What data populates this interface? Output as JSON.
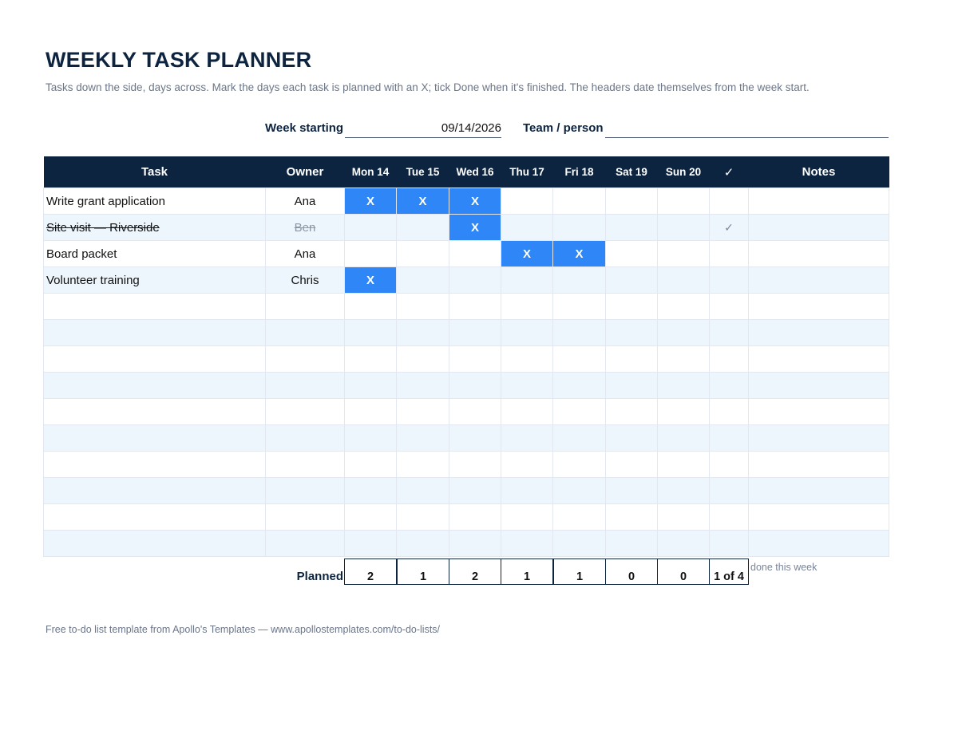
{
  "title": "WEEKLY TASK PLANNER",
  "subtitle": "Tasks down the side, days across. Mark the days each task is planned with an X; tick Done when it's finished. The headers date themselves from the week start.",
  "fields": {
    "week_label": "Week starting",
    "week_value": "09/14/2026",
    "team_label": "Team / person",
    "team_value": ""
  },
  "headers": {
    "task": "Task",
    "owner": "Owner",
    "days": [
      "Mon 14",
      "Tue 15",
      "Wed 16",
      "Thu 17",
      "Fri 18",
      "Sat 19",
      "Sun 20"
    ],
    "done": "✓",
    "notes": "Notes"
  },
  "rows": [
    {
      "task": "Write grant application",
      "owner": "Ana",
      "days": [
        "X",
        "X",
        "X",
        "",
        "",
        "",
        ""
      ],
      "done": "",
      "notes": ""
    },
    {
      "task": "Site visit — Riverside",
      "owner": "Ben",
      "days": [
        "",
        "",
        "X",
        "",
        "",
        "",
        ""
      ],
      "done": "✓",
      "notes": ""
    },
    {
      "task": "Board packet",
      "owner": "Ana",
      "days": [
        "",
        "",
        "",
        "X",
        "X",
        "",
        ""
      ],
      "done": "",
      "notes": ""
    },
    {
      "task": "Volunteer training",
      "owner": "Chris",
      "days": [
        "X",
        "",
        "",
        "",
        "",
        "",
        ""
      ],
      "done": "",
      "notes": ""
    },
    {
      "task": "",
      "owner": "",
      "days": [
        "",
        "",
        "",
        "",
        "",
        "",
        ""
      ],
      "done": "",
      "notes": ""
    },
    {
      "task": "",
      "owner": "",
      "days": [
        "",
        "",
        "",
        "",
        "",
        "",
        ""
      ],
      "done": "",
      "notes": ""
    },
    {
      "task": "",
      "owner": "",
      "days": [
        "",
        "",
        "",
        "",
        "",
        "",
        ""
      ],
      "done": "",
      "notes": ""
    },
    {
      "task": "",
      "owner": "",
      "days": [
        "",
        "",
        "",
        "",
        "",
        "",
        ""
      ],
      "done": "",
      "notes": ""
    },
    {
      "task": "",
      "owner": "",
      "days": [
        "",
        "",
        "",
        "",
        "",
        "",
        ""
      ],
      "done": "",
      "notes": ""
    },
    {
      "task": "",
      "owner": "",
      "days": [
        "",
        "",
        "",
        "",
        "",
        "",
        ""
      ],
      "done": "",
      "notes": ""
    },
    {
      "task": "",
      "owner": "",
      "days": [
        "",
        "",
        "",
        "",
        "",
        "",
        ""
      ],
      "done": "",
      "notes": ""
    },
    {
      "task": "",
      "owner": "",
      "days": [
        "",
        "",
        "",
        "",
        "",
        "",
        ""
      ],
      "done": "",
      "notes": ""
    },
    {
      "task": "",
      "owner": "",
      "days": [
        "",
        "",
        "",
        "",
        "",
        "",
        ""
      ],
      "done": "",
      "notes": ""
    },
    {
      "task": "",
      "owner": "",
      "days": [
        "",
        "",
        "",
        "",
        "",
        "",
        ""
      ],
      "done": "",
      "notes": ""
    }
  ],
  "totals": {
    "label": "Planned",
    "days": [
      "2",
      "1",
      "2",
      "1",
      "1",
      "0",
      "0"
    ],
    "done": "1 of 4",
    "done_note": "done this week"
  },
  "colors": {
    "header_bg": "#0d2440",
    "mark_bg": "#2f86f6",
    "stripe_bg": "#eef6fd"
  },
  "footer": "Free to-do list template from Apollo's Templates — www.apollostemplates.com/to-do-lists/"
}
